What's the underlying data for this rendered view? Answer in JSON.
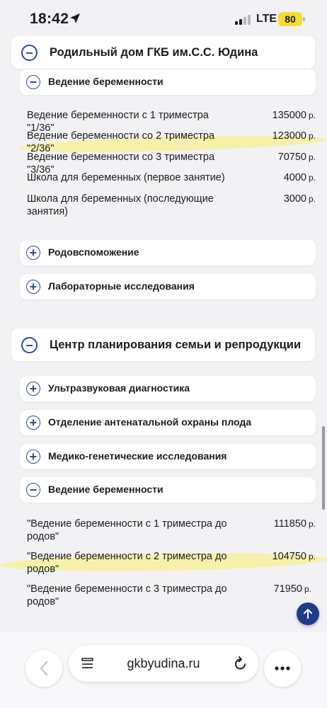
{
  "status_bar": {
    "time": "18:42",
    "network": "LTE",
    "battery": "80"
  },
  "sections": [
    {
      "title": "Родильный дом ГКБ им.С.С. Юдина",
      "expanded": true,
      "subsections": [
        {
          "title": "Ведение беременности",
          "expanded": true,
          "items": [
            {
              "name": "Ведение беременности с 1 триместра \"1/36\"",
              "price": "135000",
              "currency": "р."
            },
            {
              "name": "Ведение беременности со 2 триместра \"2/36\"",
              "price": "123000",
              "currency": "р."
            },
            {
              "name": "Ведение беременности со 3 триместра \"3/36\"",
              "price": "70750",
              "currency": "р."
            },
            {
              "name": "Школа для беременных (первое занятие)",
              "price": "4000",
              "currency": "р."
            },
            {
              "name": "Школа для беременных (последующие занятия)",
              "price": "3000",
              "currency": "р."
            }
          ]
        },
        {
          "title": "Родовспоможение",
          "expanded": false
        },
        {
          "title": "Лабораторные исследования",
          "expanded": false
        }
      ]
    },
    {
      "title": "Центр планирования семьи и репродукции",
      "expanded": true,
      "subsections": [
        {
          "title": "Ультразвуковая диагностика",
          "expanded": false
        },
        {
          "title": "Отделение антенатальной охраны плода",
          "expanded": false
        },
        {
          "title": "Медико-генетические исследования",
          "expanded": false
        },
        {
          "title": "Ведение беременности",
          "expanded": true,
          "items": [
            {
              "name": "\"Ведение беременности с 1 триместра до родов\"",
              "price": "111850",
              "currency": "р."
            },
            {
              "name": "\"Ведение беременности с 2 триместра до родов\"",
              "price": "104750",
              "currency": "р."
            },
            {
              "name": "\"Ведение беременности с 3 триместра до родов\"",
              "price": "71950",
              "currency": "р."
            }
          ]
        }
      ]
    }
  ],
  "browser": {
    "url": "gkbyudina.ru"
  },
  "colors": {
    "accent": "#2c4d95",
    "scroll_button": "#1f3c88",
    "highlight": "#f9f16e",
    "battery": "#f4dd2f"
  }
}
